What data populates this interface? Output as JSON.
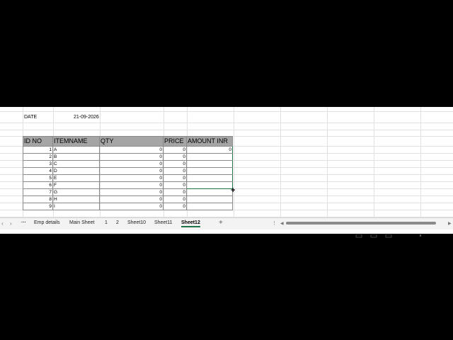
{
  "header_cells": {
    "date_label": "DATE",
    "date_value": "21-09-2026"
  },
  "table": {
    "columns": [
      "ID NO",
      "ITEMNAME",
      "QTY",
      "PRICE",
      "AMOUNT INR"
    ],
    "rows": [
      {
        "id": "1",
        "item": "A",
        "qty": "0",
        "price": "0",
        "amount": "0"
      },
      {
        "id": "2",
        "item": "B",
        "qty": "0",
        "price": "0",
        "amount": ""
      },
      {
        "id": "3",
        "item": "C",
        "qty": "0",
        "price": "0",
        "amount": ""
      },
      {
        "id": "4",
        "item": "D",
        "qty": "0",
        "price": "0",
        "amount": ""
      },
      {
        "id": "5",
        "item": "E",
        "qty": "0",
        "price": "0",
        "amount": ""
      },
      {
        "id": "6",
        "item": "F",
        "qty": "0",
        "price": "0",
        "amount": ""
      },
      {
        "id": "7",
        "item": "G",
        "qty": "0",
        "price": "0",
        "amount": ""
      },
      {
        "id": "8",
        "item": "H",
        "qty": "0",
        "price": "0",
        "amount": ""
      },
      {
        "id": "9",
        "item": "I",
        "qty": "0",
        "price": "0",
        "amount": ""
      }
    ],
    "selection_rows": [
      1,
      6
    ]
  },
  "tabs": {
    "more": "···",
    "items": [
      "Emp details",
      "Main Sheet",
      "1",
      "2",
      "Sheet10",
      "Sheet11",
      "Sheet12"
    ],
    "active": "Sheet12",
    "add": "+"
  },
  "icons": {
    "prev_sheet": "chevron-left-icon",
    "next_sheet": "chevron-right-icon",
    "more_options": "vertical-ellipsis-icon",
    "cursor": "crosshair-cursor-icon"
  },
  "colors": {
    "header_fill": "#a5a5a5",
    "selection": "#217346",
    "active_tab_underline": "#217346"
  }
}
